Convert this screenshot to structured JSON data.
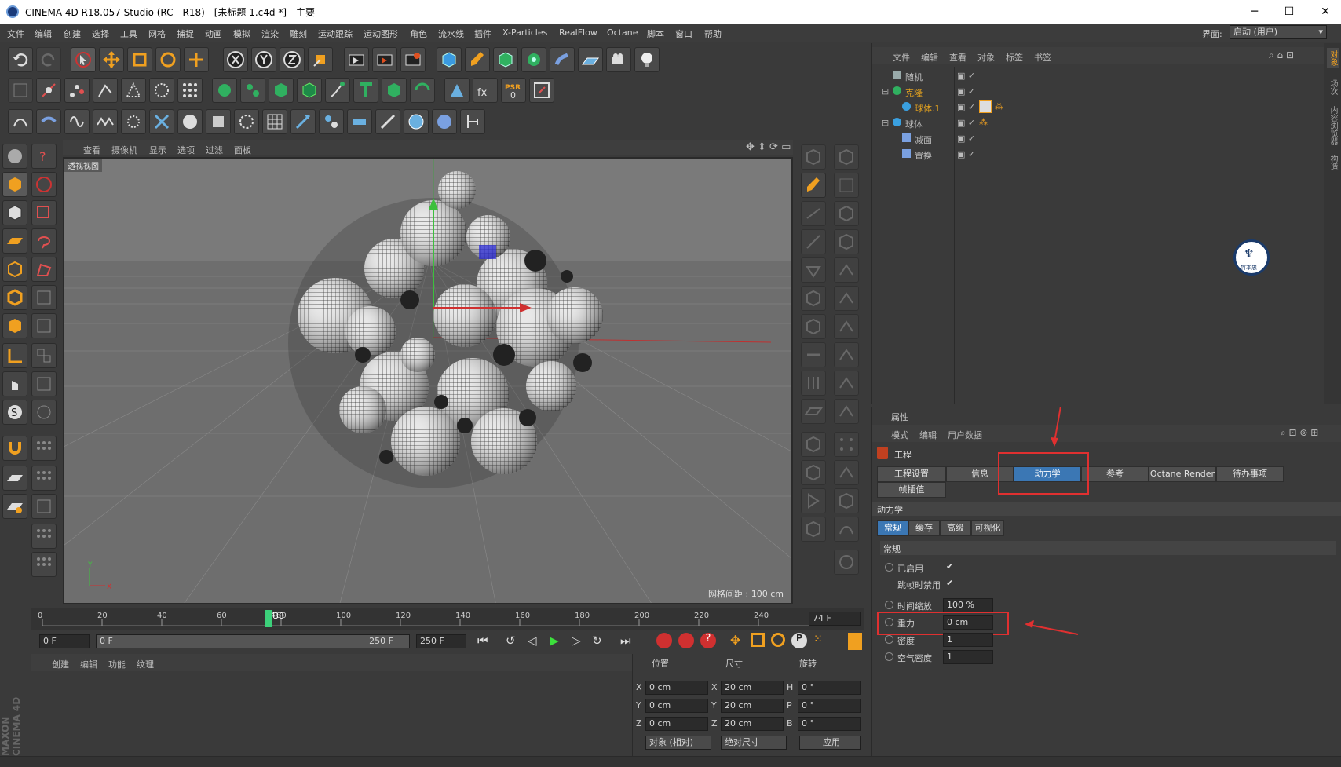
{
  "window": {
    "title": "CINEMA 4D R18.057 Studio (RC - R18) - [未标题 1.c4d *] - 主要",
    "minimize": "─",
    "maximize": "☐",
    "close": "✕"
  },
  "menu": {
    "items": [
      "文件",
      "编辑",
      "创建",
      "选择",
      "工具",
      "网格",
      "捕捉",
      "动画",
      "模拟",
      "渲染",
      "雕刻",
      "运动跟踪",
      "运动图形",
      "角色",
      "流水线",
      "插件",
      "X-Particles",
      "RealFlow",
      "Octane",
      "脚本",
      "窗口",
      "帮助"
    ],
    "layout_label": "界面:",
    "layout_value": "启动 (用户)"
  },
  "viewport": {
    "menu": [
      "查看",
      "摄像机",
      "显示",
      "选项",
      "过滤",
      "面板"
    ],
    "label": "透视视图",
    "grid_info": "网格间距 : 100 cm",
    "axis_y": "Y",
    "axis_x": "X"
  },
  "toolbar": {
    "psr_label": "PSR",
    "psr_value": "0"
  },
  "timeline": {
    "ticks": [
      "0",
      "20",
      "40",
      "60",
      "80",
      "100",
      "120",
      "140",
      "160",
      "180",
      "200",
      "220",
      "240"
    ],
    "current_frame_label": "74",
    "current_frame_suffix": "30",
    "end_label": "74 F",
    "start_field": "0 F",
    "slider_start": "0 F",
    "slider_end": "250 F",
    "end_field": "250 F"
  },
  "material_panel": {
    "menu": [
      "创建",
      "编辑",
      "功能",
      "纹理"
    ]
  },
  "coords": {
    "headers": [
      "位置",
      "尺寸",
      "旋转"
    ],
    "rows": [
      {
        "axis": "X",
        "pos": "0 cm",
        "size": "20 cm",
        "rot_axis": "H",
        "rot": "0 °"
      },
      {
        "axis": "Y",
        "pos": "0 cm",
        "size": "20 cm",
        "rot_axis": "P",
        "rot": "0 °"
      },
      {
        "axis": "Z",
        "pos": "0 cm",
        "size": "20 cm",
        "rot_axis": "B",
        "rot": "0 °"
      }
    ],
    "mode1": "对象 (相对)",
    "mode2": "绝对尺寸",
    "apply": "应用"
  },
  "objects_panel": {
    "menu": [
      "文件",
      "编辑",
      "查看",
      "对象",
      "标签",
      "书签"
    ],
    "items": [
      {
        "name": "随机",
        "indent": 1,
        "color": "#bdbdbd"
      },
      {
        "name": "克隆",
        "indent": 0,
        "color": "#e0a020"
      },
      {
        "name": "球体.1",
        "indent": 2,
        "color": "#e0a020"
      },
      {
        "name": "球体",
        "indent": 0,
        "color": "#bdbdbd"
      },
      {
        "name": "减面",
        "indent": 1,
        "color": "#bdbdbd"
      },
      {
        "name": "置换",
        "indent": 1,
        "color": "#bdbdbd"
      }
    ],
    "right_tabs": [
      "对象",
      "场次",
      "内容浏览器",
      "构造"
    ]
  },
  "attributes": {
    "title": "属性",
    "menu": [
      "模式",
      "编辑",
      "用户数据"
    ],
    "object_label": "工程",
    "tabs": [
      "工程设置",
      "信息",
      "动力学",
      "参考",
      "Octane Render",
      "待办事项",
      "帧插值"
    ],
    "active_tab": "动力学",
    "section": "动力学",
    "subtabs": [
      "常规",
      "缓存",
      "高级",
      "可视化"
    ],
    "group": "常规",
    "params": [
      {
        "label": "已启用",
        "value": "✔",
        "type": "check"
      },
      {
        "label": "跳帧时禁用",
        "value": "✔",
        "type": "check"
      },
      {
        "label": "时间缩放",
        "value": "100 %",
        "type": "field"
      },
      {
        "label": "重力",
        "value": "0 cm",
        "type": "field"
      },
      {
        "label": "密度",
        "value": "1",
        "type": "field"
      },
      {
        "label": "空气密度",
        "value": "1",
        "type": "field"
      }
    ]
  },
  "watermark": {
    "text": "竹本忠"
  },
  "brand": {
    "line1": "MAXON",
    "line2": "CINEMA 4D"
  }
}
